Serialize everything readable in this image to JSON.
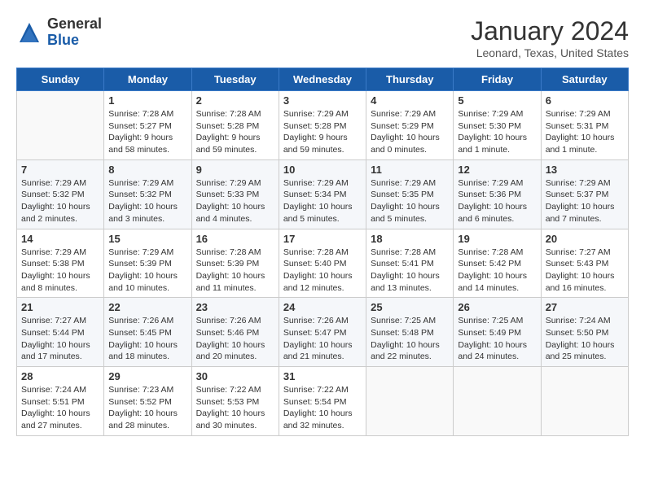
{
  "header": {
    "logo_general": "General",
    "logo_blue": "Blue",
    "month_year": "January 2024",
    "location": "Leonard, Texas, United States"
  },
  "weekdays": [
    "Sunday",
    "Monday",
    "Tuesday",
    "Wednesday",
    "Thursday",
    "Friday",
    "Saturday"
  ],
  "weeks": [
    [
      {
        "day": "",
        "sunrise": "",
        "sunset": "",
        "daylight": ""
      },
      {
        "day": "1",
        "sunrise": "Sunrise: 7:28 AM",
        "sunset": "Sunset: 5:27 PM",
        "daylight": "Daylight: 9 hours and 58 minutes."
      },
      {
        "day": "2",
        "sunrise": "Sunrise: 7:28 AM",
        "sunset": "Sunset: 5:28 PM",
        "daylight": "Daylight: 9 hours and 59 minutes."
      },
      {
        "day": "3",
        "sunrise": "Sunrise: 7:29 AM",
        "sunset": "Sunset: 5:28 PM",
        "daylight": "Daylight: 9 hours and 59 minutes."
      },
      {
        "day": "4",
        "sunrise": "Sunrise: 7:29 AM",
        "sunset": "Sunset: 5:29 PM",
        "daylight": "Daylight: 10 hours and 0 minutes."
      },
      {
        "day": "5",
        "sunrise": "Sunrise: 7:29 AM",
        "sunset": "Sunset: 5:30 PM",
        "daylight": "Daylight: 10 hours and 1 minute."
      },
      {
        "day": "6",
        "sunrise": "Sunrise: 7:29 AM",
        "sunset": "Sunset: 5:31 PM",
        "daylight": "Daylight: 10 hours and 1 minute."
      }
    ],
    [
      {
        "day": "7",
        "sunrise": "Sunrise: 7:29 AM",
        "sunset": "Sunset: 5:32 PM",
        "daylight": "Daylight: 10 hours and 2 minutes."
      },
      {
        "day": "8",
        "sunrise": "Sunrise: 7:29 AM",
        "sunset": "Sunset: 5:32 PM",
        "daylight": "Daylight: 10 hours and 3 minutes."
      },
      {
        "day": "9",
        "sunrise": "Sunrise: 7:29 AM",
        "sunset": "Sunset: 5:33 PM",
        "daylight": "Daylight: 10 hours and 4 minutes."
      },
      {
        "day": "10",
        "sunrise": "Sunrise: 7:29 AM",
        "sunset": "Sunset: 5:34 PM",
        "daylight": "Daylight: 10 hours and 5 minutes."
      },
      {
        "day": "11",
        "sunrise": "Sunrise: 7:29 AM",
        "sunset": "Sunset: 5:35 PM",
        "daylight": "Daylight: 10 hours and 5 minutes."
      },
      {
        "day": "12",
        "sunrise": "Sunrise: 7:29 AM",
        "sunset": "Sunset: 5:36 PM",
        "daylight": "Daylight: 10 hours and 6 minutes."
      },
      {
        "day": "13",
        "sunrise": "Sunrise: 7:29 AM",
        "sunset": "Sunset: 5:37 PM",
        "daylight": "Daylight: 10 hours and 7 minutes."
      }
    ],
    [
      {
        "day": "14",
        "sunrise": "Sunrise: 7:29 AM",
        "sunset": "Sunset: 5:38 PM",
        "daylight": "Daylight: 10 hours and 8 minutes."
      },
      {
        "day": "15",
        "sunrise": "Sunrise: 7:29 AM",
        "sunset": "Sunset: 5:39 PM",
        "daylight": "Daylight: 10 hours and 10 minutes."
      },
      {
        "day": "16",
        "sunrise": "Sunrise: 7:28 AM",
        "sunset": "Sunset: 5:39 PM",
        "daylight": "Daylight: 10 hours and 11 minutes."
      },
      {
        "day": "17",
        "sunrise": "Sunrise: 7:28 AM",
        "sunset": "Sunset: 5:40 PM",
        "daylight": "Daylight: 10 hours and 12 minutes."
      },
      {
        "day": "18",
        "sunrise": "Sunrise: 7:28 AM",
        "sunset": "Sunset: 5:41 PM",
        "daylight": "Daylight: 10 hours and 13 minutes."
      },
      {
        "day": "19",
        "sunrise": "Sunrise: 7:28 AM",
        "sunset": "Sunset: 5:42 PM",
        "daylight": "Daylight: 10 hours and 14 minutes."
      },
      {
        "day": "20",
        "sunrise": "Sunrise: 7:27 AM",
        "sunset": "Sunset: 5:43 PM",
        "daylight": "Daylight: 10 hours and 16 minutes."
      }
    ],
    [
      {
        "day": "21",
        "sunrise": "Sunrise: 7:27 AM",
        "sunset": "Sunset: 5:44 PM",
        "daylight": "Daylight: 10 hours and 17 minutes."
      },
      {
        "day": "22",
        "sunrise": "Sunrise: 7:26 AM",
        "sunset": "Sunset: 5:45 PM",
        "daylight": "Daylight: 10 hours and 18 minutes."
      },
      {
        "day": "23",
        "sunrise": "Sunrise: 7:26 AM",
        "sunset": "Sunset: 5:46 PM",
        "daylight": "Daylight: 10 hours and 20 minutes."
      },
      {
        "day": "24",
        "sunrise": "Sunrise: 7:26 AM",
        "sunset": "Sunset: 5:47 PM",
        "daylight": "Daylight: 10 hours and 21 minutes."
      },
      {
        "day": "25",
        "sunrise": "Sunrise: 7:25 AM",
        "sunset": "Sunset: 5:48 PM",
        "daylight": "Daylight: 10 hours and 22 minutes."
      },
      {
        "day": "26",
        "sunrise": "Sunrise: 7:25 AM",
        "sunset": "Sunset: 5:49 PM",
        "daylight": "Daylight: 10 hours and 24 minutes."
      },
      {
        "day": "27",
        "sunrise": "Sunrise: 7:24 AM",
        "sunset": "Sunset: 5:50 PM",
        "daylight": "Daylight: 10 hours and 25 minutes."
      }
    ],
    [
      {
        "day": "28",
        "sunrise": "Sunrise: 7:24 AM",
        "sunset": "Sunset: 5:51 PM",
        "daylight": "Daylight: 10 hours and 27 minutes."
      },
      {
        "day": "29",
        "sunrise": "Sunrise: 7:23 AM",
        "sunset": "Sunset: 5:52 PM",
        "daylight": "Daylight: 10 hours and 28 minutes."
      },
      {
        "day": "30",
        "sunrise": "Sunrise: 7:22 AM",
        "sunset": "Sunset: 5:53 PM",
        "daylight": "Daylight: 10 hours and 30 minutes."
      },
      {
        "day": "31",
        "sunrise": "Sunrise: 7:22 AM",
        "sunset": "Sunset: 5:54 PM",
        "daylight": "Daylight: 10 hours and 32 minutes."
      },
      {
        "day": "",
        "sunrise": "",
        "sunset": "",
        "daylight": ""
      },
      {
        "day": "",
        "sunrise": "",
        "sunset": "",
        "daylight": ""
      },
      {
        "day": "",
        "sunrise": "",
        "sunset": "",
        "daylight": ""
      }
    ]
  ]
}
